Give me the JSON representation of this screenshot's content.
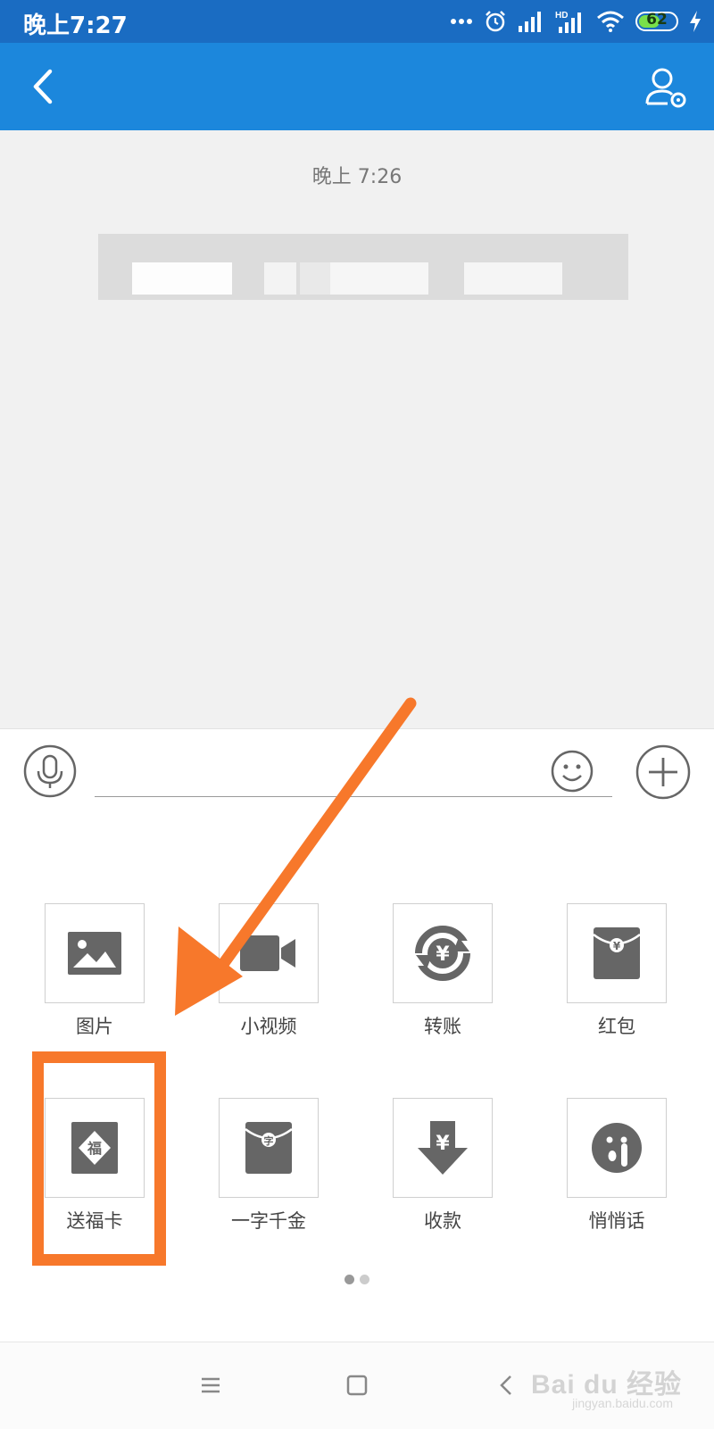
{
  "status_bar": {
    "time": "晚上7:27",
    "hd_label": "HD",
    "battery_percent": "62",
    "battery_level": 0.62,
    "icons": [
      "dots-icon",
      "alarm-icon",
      "signal-icon",
      "hd-signal-icon",
      "wifi-icon",
      "battery-icon",
      "charging-icon"
    ]
  },
  "header": {
    "back_icon": "chevron-left-icon",
    "profile_icon": "user-settings-icon"
  },
  "chat": {
    "timestamp": "晚上 7:26"
  },
  "input_bar": {
    "voice_icon": "microphone-icon",
    "emoji_icon": "smiley-icon",
    "more_icon": "plus-icon",
    "text_value": ""
  },
  "tools": [
    {
      "label": "图片",
      "icon": "image-icon"
    },
    {
      "label": "小视频",
      "icon": "video-camera-icon"
    },
    {
      "label": "转账",
      "icon": "transfer-icon"
    },
    {
      "label": "红包",
      "icon": "red-packet-icon"
    },
    {
      "label": "送福卡",
      "icon": "fu-card-icon"
    },
    {
      "label": "一字千金",
      "icon": "character-envelope-icon"
    },
    {
      "label": "收款",
      "icon": "receive-money-icon"
    },
    {
      "label": "悄悄话",
      "icon": "whisper-icon"
    }
  ],
  "pager": {
    "pages": 2,
    "current": 1
  },
  "nav_bar": {
    "icons": [
      "menu-icon",
      "home-square-icon",
      "back-arrow-icon"
    ],
    "watermark": "Bai du 经验",
    "watermark_sub": "jingyan.baidu.com"
  },
  "colors": {
    "status_bar": "#1a6cc2",
    "header": "#1c87dc",
    "annotation": "#f7782b",
    "icon_gray": "#666666"
  }
}
